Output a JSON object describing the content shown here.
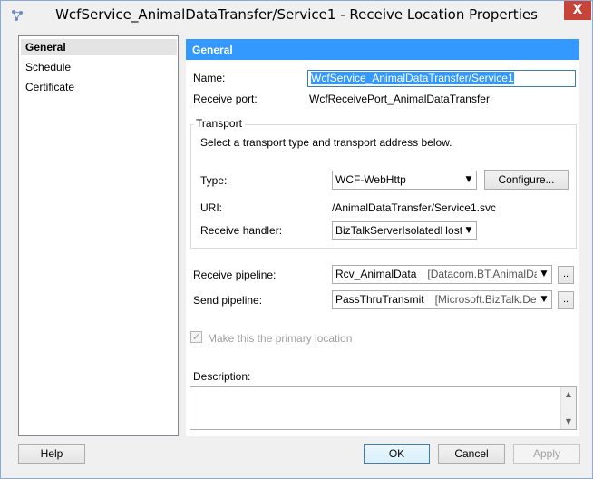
{
  "window": {
    "title": "WcfService_AnimalDataTransfer/Service1 - Receive Location Properties",
    "close_label": "X"
  },
  "sidebar": {
    "items": [
      {
        "label": "General",
        "selected": true
      },
      {
        "label": "Schedule",
        "selected": false
      },
      {
        "label": "Certificate",
        "selected": false
      }
    ]
  },
  "general": {
    "header": "General",
    "name_label": "Name:",
    "name_value": "WcfService_AnimalDataTransfer/Service1",
    "receive_port_label": "Receive port:",
    "receive_port_value": "WcfReceivePort_AnimalDataTransfer",
    "transport": {
      "title": "Transport",
      "description": "Select a transport type and transport address below.",
      "type_label": "Type:",
      "type_value": "WCF-WebHttp",
      "configure_label": "Configure...",
      "uri_label": "URI:",
      "uri_value": "/AnimalDataTransfer/Service1.svc",
      "handler_label": "Receive handler:",
      "handler_value": "BizTalkServerIsolatedHost"
    },
    "receive_pipeline_label": "Receive pipeline:",
    "receive_pipeline_name": "Rcv_AnimalData",
    "receive_pipeline_assembly": "[Datacom.BT.AnimalData",
    "send_pipeline_label": "Send pipeline:",
    "send_pipeline_name": "PassThruTransmit",
    "send_pipeline_assembly": "[Microsoft.BizTalk.Defau",
    "ellipsis": "..",
    "primary_location_label": "Make this the primary location",
    "primary_location_checked": true,
    "description_label": "Description:",
    "description_value": ""
  },
  "footer": {
    "help": "Help",
    "ok": "OK",
    "cancel": "Cancel",
    "apply": "Apply"
  }
}
